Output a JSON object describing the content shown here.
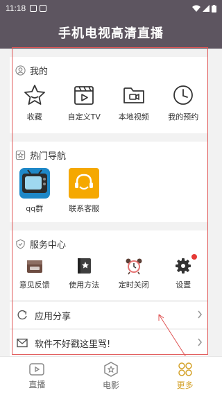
{
  "status_bar": {
    "time": "11:18"
  },
  "header": {
    "title": "手机电视高清直播"
  },
  "my_section": {
    "title": "我的",
    "items": [
      {
        "label": "收藏",
        "icon": "star-icon"
      },
      {
        "label": "自定义TV",
        "icon": "clapperboard-icon"
      },
      {
        "label": "本地视频",
        "icon": "video-folder-icon"
      },
      {
        "label": "我的预约",
        "icon": "clock-icon"
      }
    ]
  },
  "hot_section": {
    "title": "热门导航",
    "items": [
      {
        "label": "qq群",
        "icon": "retro-tv-icon"
      },
      {
        "label": "联系客服",
        "icon": "headset-icon"
      }
    ]
  },
  "service_section": {
    "title": "服务中心",
    "items": [
      {
        "label": "意见反馈",
        "icon": "feedback-icon"
      },
      {
        "label": "使用方法",
        "icon": "manual-icon"
      },
      {
        "label": "定时关闭",
        "icon": "alarm-clock-icon"
      },
      {
        "label": "设置",
        "icon": "gear-icon"
      }
    ]
  },
  "list": [
    {
      "label": "应用分享",
      "icon": "share-icon"
    },
    {
      "label": "软件不好戳这里骂!",
      "icon": "mail-icon"
    }
  ],
  "bottom_nav": [
    {
      "label": "直播",
      "icon": "live-icon"
    },
    {
      "label": "电影",
      "icon": "movie-icon"
    },
    {
      "label": "更多",
      "icon": "more-icon",
      "active": true
    }
  ],
  "colors": {
    "header": "#5d5560",
    "accent": "#d4a22a",
    "annotation": "#e05555",
    "badge": "#e53935"
  }
}
